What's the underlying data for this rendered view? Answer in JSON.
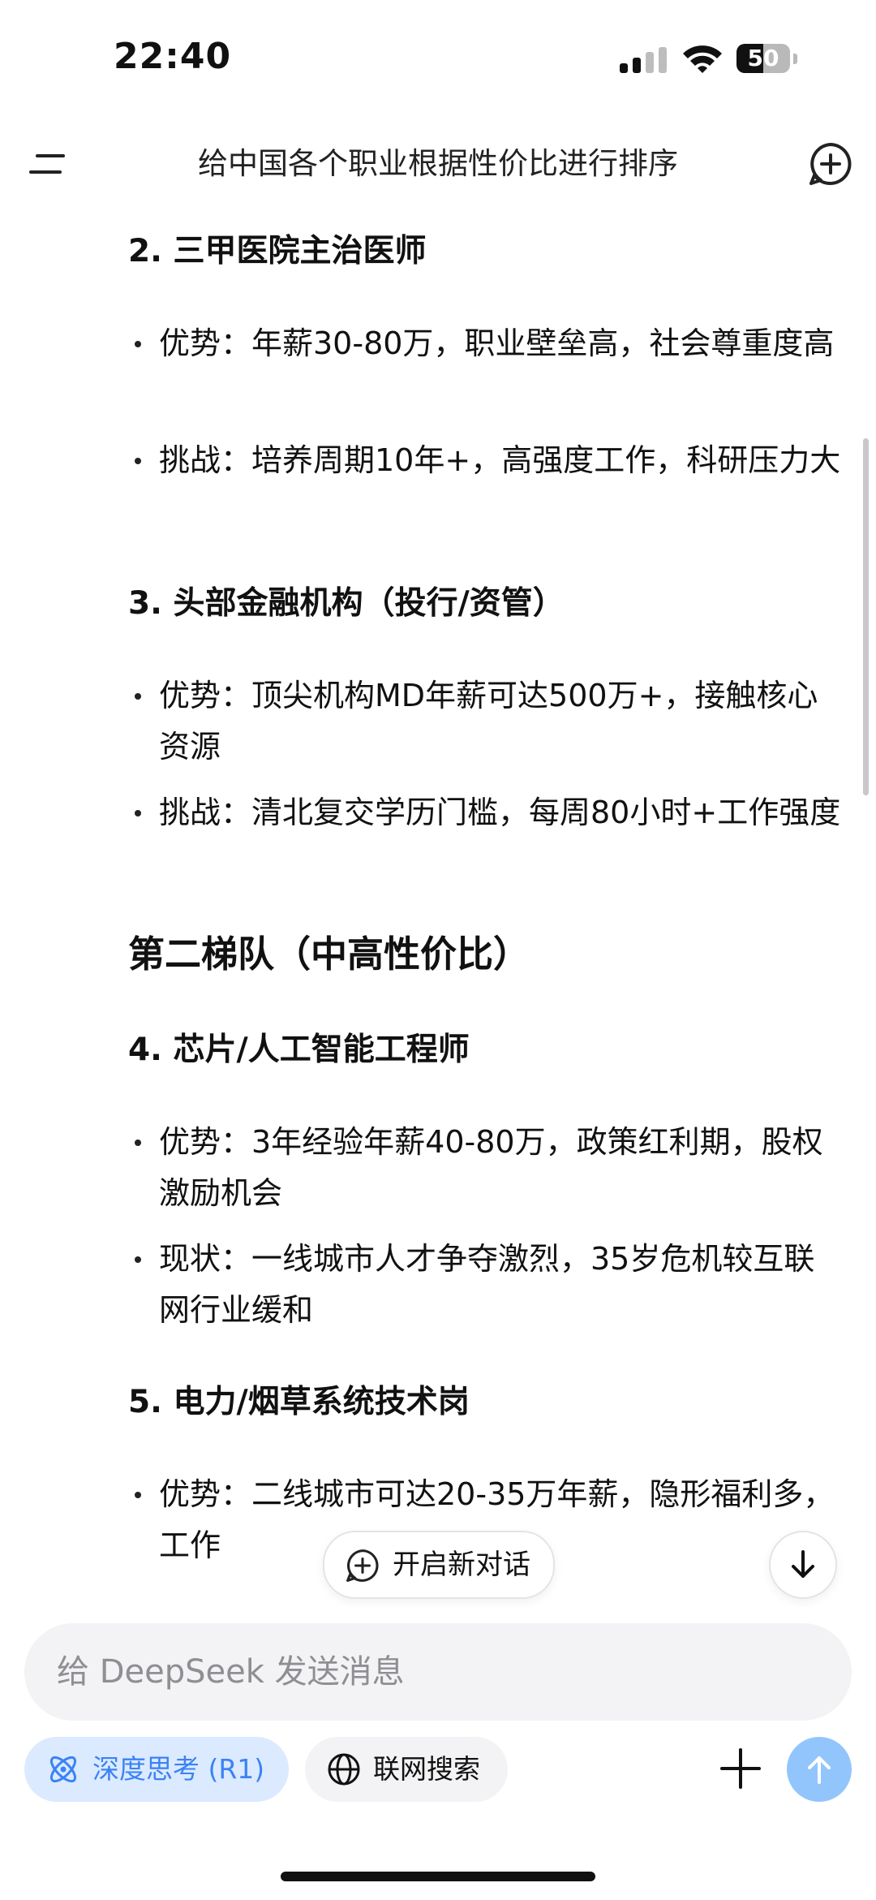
{
  "status_bar": {
    "time": "22:40",
    "battery": "50",
    "battery_level": 0.5
  },
  "header": {
    "title": "给中国各个职业根据性价比进行排序"
  },
  "content": {
    "s2": {
      "title": "2. 三甲医院主治医师",
      "b1": "优势：年薪30-80万，职业壁垒高，社会尊重度高",
      "b2": "挑战：培养周期10年+，高强度工作，科研压力大"
    },
    "s3": {
      "title": "3. 头部金融机构（投行/资管）",
      "b1": "优势：顶尖机构MD年薪可达500万+，接触核心资源",
      "b2": "挑战：清北复交学历门槛，每周80小时+工作强度"
    },
    "tier2": "第二梯队（中高性价比）",
    "s4": {
      "title": "4. 芯片/人工智能工程师",
      "b1": "优势：3年经验年薪40-80万，政策红利期，股权激励机会",
      "b2": "现状：一线城市人才争夺激烈，35岁危机较互联网行业缓和"
    },
    "s5": {
      "title": "5. 电力/烟草系统技术岗",
      "b1": "优势：二线城市可达20-35万年薪，隐形福利多，工作"
    }
  },
  "new_chat_pill": "开启新对话",
  "input": {
    "placeholder": "给 DeepSeek 发送消息"
  },
  "buttons": {
    "deep_think": "深度思考 (R1)",
    "web_search": "联网搜索"
  }
}
